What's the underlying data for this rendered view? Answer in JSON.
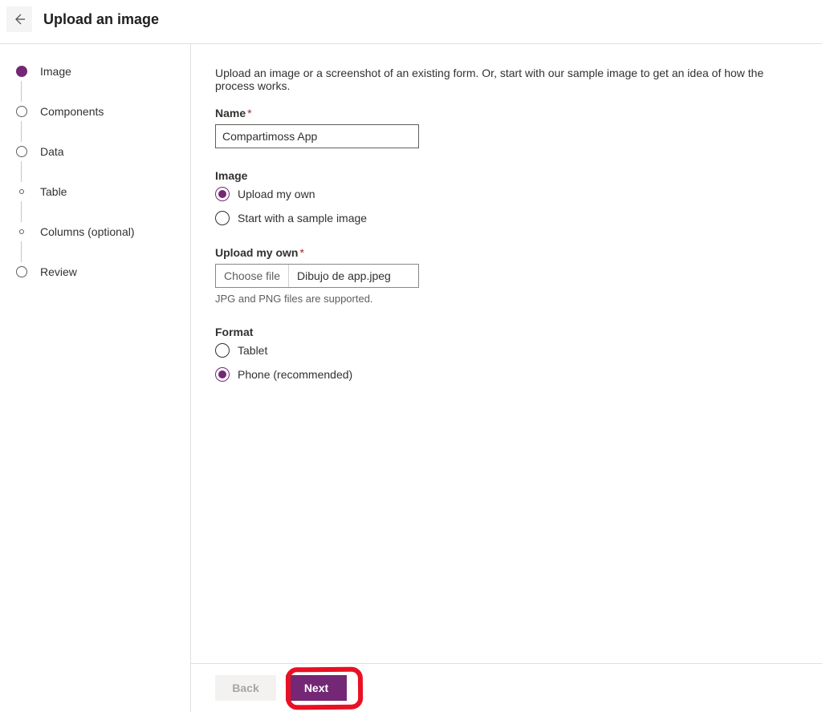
{
  "header": {
    "title": "Upload an image"
  },
  "sidebar": {
    "steps": [
      {
        "label": "Image",
        "variant": "active"
      },
      {
        "label": "Components",
        "variant": "normal"
      },
      {
        "label": "Data",
        "variant": "normal"
      },
      {
        "label": "Table",
        "variant": "small"
      },
      {
        "label": "Columns (optional)",
        "variant": "small"
      },
      {
        "label": "Review",
        "variant": "normal"
      }
    ]
  },
  "content": {
    "intro": "Upload an image or a screenshot of an existing form. Or, start with our sample image to get an idea of how the process works.",
    "name_label": "Name",
    "name_value": "Compartimoss App",
    "image_label": "Image",
    "image_options": {
      "upload": "Upload my own",
      "sample": "Start with a sample image"
    },
    "upload_label": "Upload my own",
    "choose_file_label": "Choose file",
    "file_name": "Dibujo de app.jpeg",
    "upload_helper": "JPG and PNG files are supported.",
    "format_label": "Format",
    "format_options": {
      "tablet": "Tablet",
      "phone": "Phone (recommended)"
    }
  },
  "footer": {
    "back": "Back",
    "next": "Next"
  }
}
